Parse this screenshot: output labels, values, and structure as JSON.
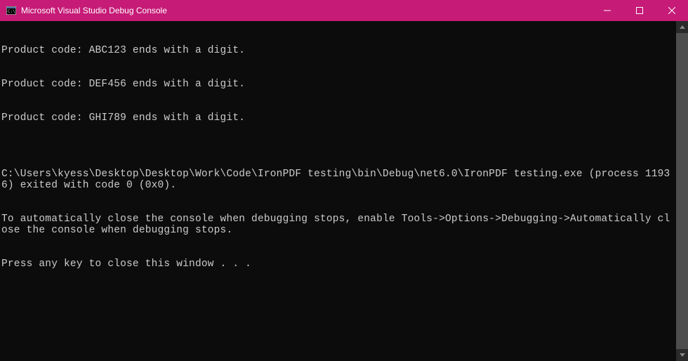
{
  "titlebar": {
    "title": "Microsoft Visual Studio Debug Console"
  },
  "console": {
    "lines": [
      "Product code: ABC123 ends with a digit.",
      "Product code: DEF456 ends with a digit.",
      "Product code: GHI789 ends with a digit.",
      "",
      "C:\\Users\\kyess\\Desktop\\Desktop\\Work\\Code\\IronPDF testing\\bin\\Debug\\net6.0\\IronPDF testing.exe (process 11936) exited with code 0 (0x0).",
      "To automatically close the console when debugging stops, enable Tools->Options->Debugging->Automatically close the console when debugging stops.",
      "Press any key to close this window . . ."
    ]
  }
}
